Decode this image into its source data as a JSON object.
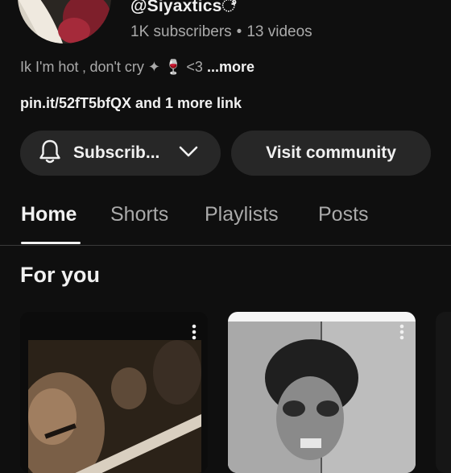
{
  "channel": {
    "handle": "@Siyaxticsೆ",
    "subscribers": "1K subscribers",
    "separator": "•",
    "videos": "13 videos",
    "description": "Ik I'm hot ‚ don't cry  ✦ 🍷 <3",
    "description_more": " ...more",
    "link": "pin.it/52fT5bfQX",
    "link_more": " and 1 more link"
  },
  "actions": {
    "subscribe_label": "Subscrib...",
    "community_label": "Visit community"
  },
  "tabs": [
    {
      "label": "Home",
      "active": true
    },
    {
      "label": "Shorts",
      "active": false
    },
    {
      "label": "Playlists",
      "active": false
    },
    {
      "label": "Posts",
      "active": false
    }
  ],
  "section": {
    "title": "For you"
  },
  "icons": {
    "bell": "bell-icon",
    "chevron": "chevron-down-icon",
    "kebab": "more-vert-icon"
  },
  "colors": {
    "background": "#0f0f0f",
    "pill": "#272727",
    "text_primary": "#f1f1f1",
    "text_secondary": "#aaaaaa"
  }
}
